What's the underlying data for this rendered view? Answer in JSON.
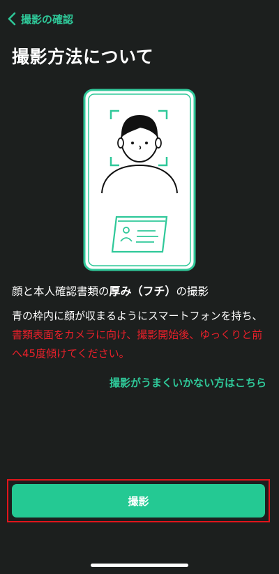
{
  "header": {
    "back_label": "撮影の確認"
  },
  "page_title": "撮影方法について",
  "description": {
    "part1": "顔と本人確認書類の",
    "bold": "厚み（フチ）",
    "part2": "の撮影"
  },
  "instructions": {
    "normal": "青の枠内に顔が収まるようにスマートフォンを持ち、",
    "red": "書類表面をカメラに向け、撮影開始後、ゆっくりと前へ45度傾けてください。"
  },
  "help_link": "撮影がうまくいかない方はこちら",
  "capture_button": "撮影",
  "colors": {
    "accent": "#2fc899",
    "button": "#24c993",
    "warning": "#e8202a",
    "highlight_frame": "#e0151b"
  },
  "icons": {
    "back": "chevron-left-icon"
  }
}
